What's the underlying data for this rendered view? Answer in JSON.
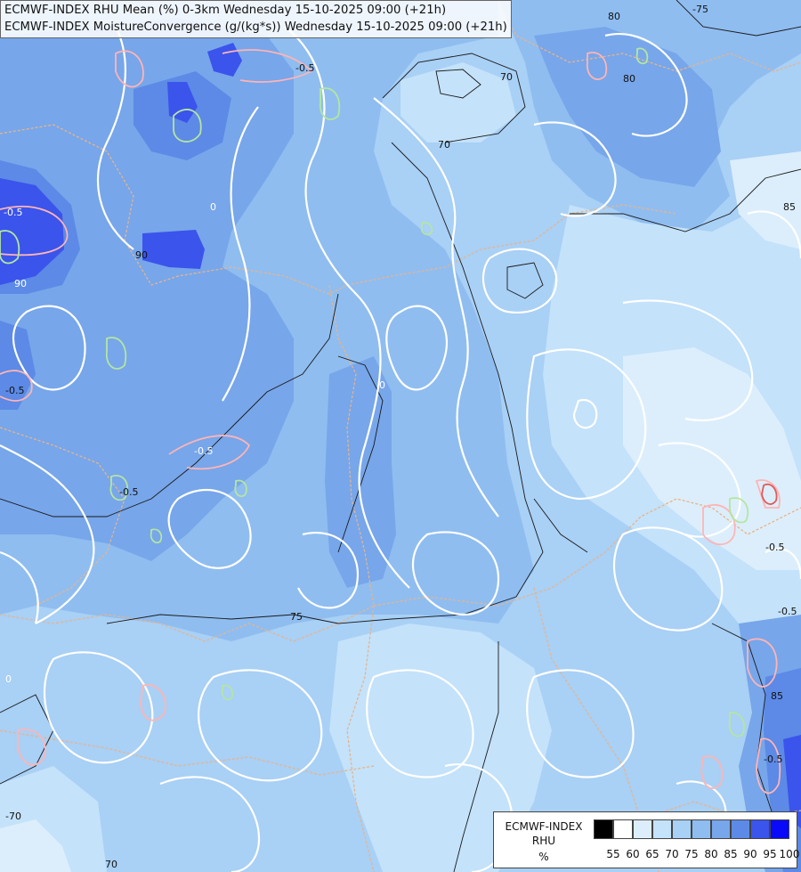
{
  "titles": {
    "line1": "ECMWF-INDEX RHU Mean (%) 0-3km Wednesday 15-10-2025 09:00 (+21h)",
    "line2": "ECMWF-INDEX MoistureConvergence (g/(kg*s)) Wednesday 15-10-2025 09:00 (+21h)"
  },
  "legend": {
    "line1": "ECMWF-INDEX",
    "line2": "RHU",
    "line3": "%",
    "colors": [
      "#000000",
      "#ffffff",
      "#dceefc",
      "#c4e2fa",
      "#a9d0f5",
      "#8fbdf0",
      "#77a6ea",
      "#5c8ae6",
      "#3b54ec",
      "#0a0afa"
    ],
    "ticks": [
      "55",
      "60",
      "65",
      "70",
      "75",
      "80",
      "85",
      "90",
      "95",
      "100"
    ]
  },
  "contour_labels": [
    {
      "text": "-75"
    },
    {
      "text": "80"
    },
    {
      "text": "80"
    },
    {
      "text": "70"
    },
    {
      "text": "70"
    },
    {
      "text": "-0.5"
    },
    {
      "text": "-0.5"
    },
    {
      "text": "90"
    },
    {
      "text": "90"
    },
    {
      "text": "-0.5"
    },
    {
      "text": "-0.5"
    },
    {
      "text": "85"
    },
    {
      "text": "75"
    },
    {
      "text": "-0.5"
    },
    {
      "text": "85"
    },
    {
      "text": "-0.5"
    },
    {
      "text": "70"
    },
    {
      "text": "-70"
    },
    {
      "text": "-0.5"
    },
    {
      "text": "-0.5"
    },
    {
      "text": "0"
    },
    {
      "text": "0"
    },
    {
      "text": "0"
    }
  ],
  "colors": {
    "moisture_positive": "#ffffff",
    "moisture_negative": "#ffb4b4",
    "moisture_positive_strong": "#b4e6a0",
    "rhu_isoline": "#111111",
    "border": "#e6b48c"
  }
}
